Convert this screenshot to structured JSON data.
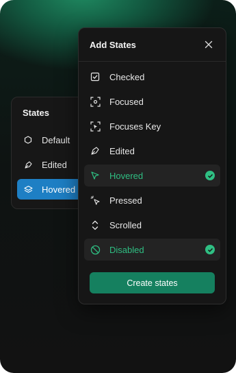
{
  "states_panel": {
    "title": "States",
    "items": [
      {
        "label": "Default",
        "icon": "hexagon-icon"
      },
      {
        "label": "Edited",
        "icon": "pen-nib-icon"
      },
      {
        "label": "Hovered + D",
        "icon": "layers-icon",
        "active": true
      }
    ]
  },
  "modal": {
    "title": "Add States",
    "options": [
      {
        "label": "Checked",
        "icon": "checkbox-icon",
        "selected": false
      },
      {
        "label": "Focused",
        "icon": "focus-frame-icon",
        "selected": false
      },
      {
        "label": "Focuses Key",
        "icon": "focus-key-icon",
        "selected": false
      },
      {
        "label": "Edited",
        "icon": "pen-nib-icon",
        "selected": false
      },
      {
        "label": "Hovered",
        "icon": "cursor-icon",
        "selected": true
      },
      {
        "label": "Pressed",
        "icon": "pressed-cursor-icon",
        "selected": false
      },
      {
        "label": "Scrolled",
        "icon": "scroll-icon",
        "selected": false
      },
      {
        "label": "Disabled",
        "icon": "disabled-icon",
        "selected": true
      }
    ],
    "create_button": "Create states"
  },
  "colors": {
    "accent": "#2fbf83",
    "button": "#15805f",
    "active_blue": "#1e7fc4"
  }
}
